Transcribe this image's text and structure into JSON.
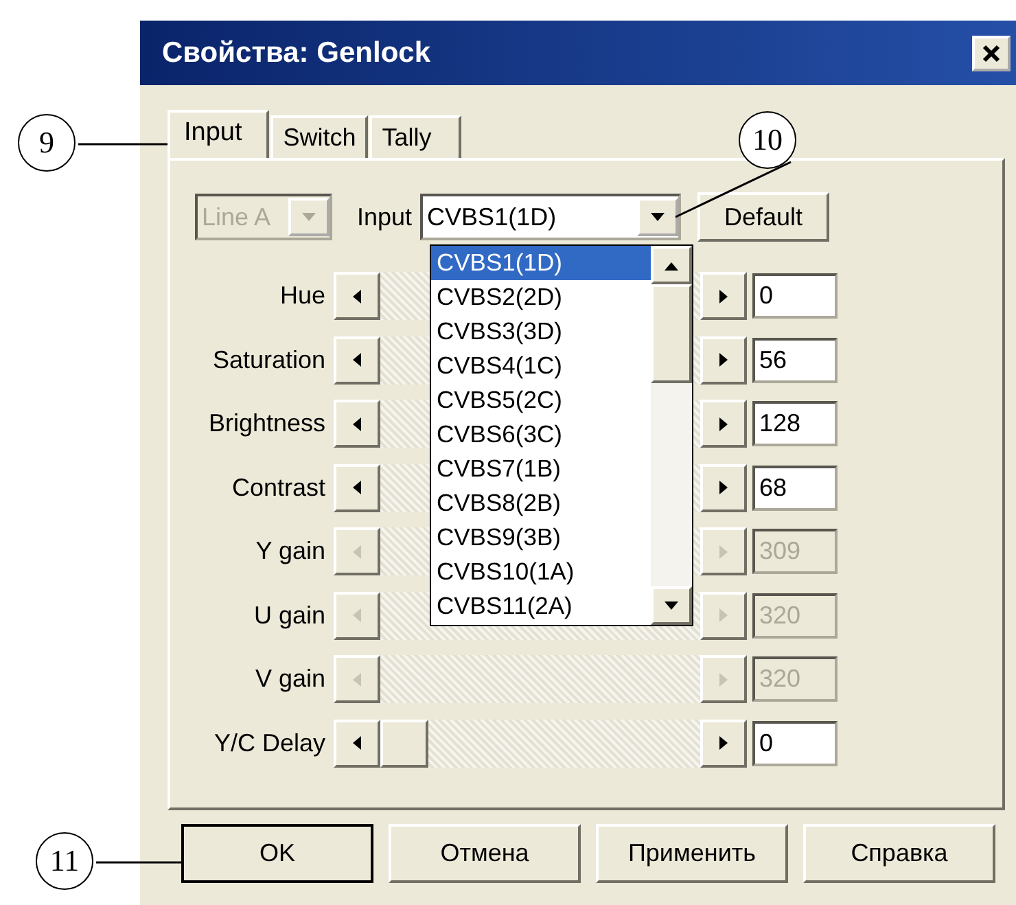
{
  "window": {
    "title": "Свойства: Genlock"
  },
  "tabs": [
    {
      "label": "Input",
      "selected": true
    },
    {
      "label": "Switch",
      "selected": false
    },
    {
      "label": "Tally",
      "selected": false
    }
  ],
  "line_combo": {
    "value": "Line A",
    "disabled": true
  },
  "input_label": "Input",
  "input_combo": {
    "value": "CVBS1(1D)"
  },
  "default_button": "Default",
  "dropdown": {
    "items": [
      {
        "label": "CVBS1(1D)",
        "selected": true
      },
      {
        "label": "CVBS2(2D)",
        "selected": false
      },
      {
        "label": "CVBS3(3D)",
        "selected": false
      },
      {
        "label": "CVBS4(1C)",
        "selected": false
      },
      {
        "label": "CVBS5(2C)",
        "selected": false
      },
      {
        "label": "CVBS6(3C)",
        "selected": false
      },
      {
        "label": "CVBS7(1B)",
        "selected": false
      },
      {
        "label": "CVBS8(2B)",
        "selected": false
      },
      {
        "label": "CVBS9(3B)",
        "selected": false
      },
      {
        "label": "CVBS10(1A)",
        "selected": false
      },
      {
        "label": "CVBS11(2A)",
        "selected": false
      }
    ]
  },
  "sliders": [
    {
      "label": "Hue",
      "value": "0",
      "disabled": false
    },
    {
      "label": "Saturation",
      "value": "56",
      "disabled": false
    },
    {
      "label": "Brightness",
      "value": "128",
      "disabled": false
    },
    {
      "label": "Contrast",
      "value": "68",
      "disabled": false
    },
    {
      "label": "Y gain",
      "value": "309",
      "disabled": true
    },
    {
      "label": "U gain",
      "value": "320",
      "disabled": true
    },
    {
      "label": "V gain",
      "value": "320",
      "disabled": true
    },
    {
      "label": "Y/C Delay",
      "value": "0",
      "disabled": false,
      "level": 0
    }
  ],
  "buttons": [
    {
      "label": "OK",
      "selected": true
    },
    {
      "label": "Отмена",
      "selected": false
    },
    {
      "label": "Применить",
      "selected": false
    },
    {
      "label": "Справка",
      "selected": false
    }
  ],
  "callouts": [
    {
      "label": "9"
    },
    {
      "label": "10"
    },
    {
      "label": "11"
    }
  ]
}
